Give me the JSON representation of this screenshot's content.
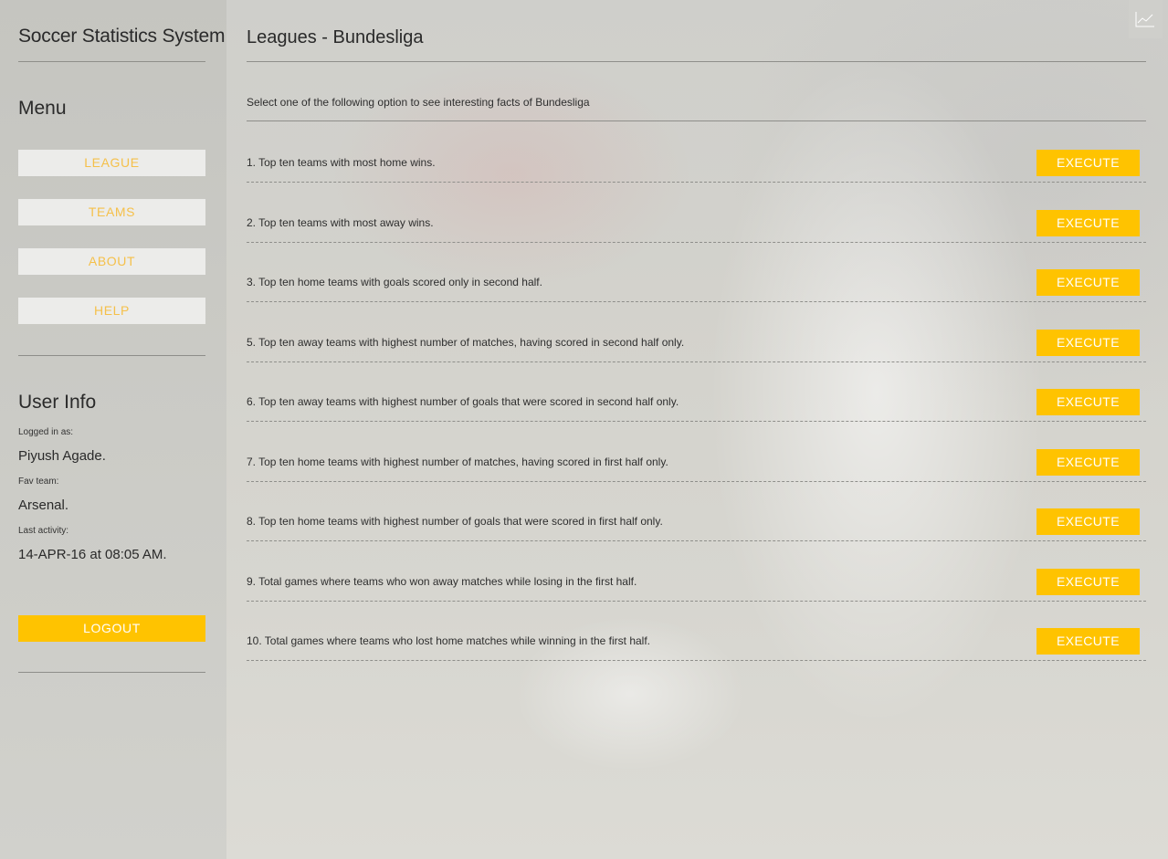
{
  "sidebar": {
    "app_title": "Soccer Statistics System",
    "menu_title": "Menu",
    "menu_items": [
      "LEAGUE",
      "TEAMS",
      "ABOUT",
      "HELP"
    ],
    "user_info": {
      "title": "User Info",
      "logged_in_label": "Logged in as:",
      "logged_in_value": "Piyush Agade.",
      "fav_team_label": "Fav team:",
      "fav_team_value": "Arsenal.",
      "last_activity_label": "Last activity:",
      "last_activity_value": "14-APR-16 at 08:05 AM."
    },
    "logout_label": "LOGOUT"
  },
  "main": {
    "page_title": "Leagues - Bundesliga",
    "intro": "Select one of the following option to see interesting facts of Bundesliga",
    "execute_label": "EXECUTE",
    "queries": [
      "1. Top ten teams with most home wins.",
      "2. Top ten teams with most away wins.",
      "3. Top ten home teams with goals scored only in second half.",
      "5. Top ten away teams with highest number of matches, having scored in second half only.",
      "6. Top ten away teams with highest number of goals that were scored in second half only.",
      "7. Top ten home teams with highest number of matches, having scored in first half only.",
      "8. Top ten home teams with highest number of goals that were scored in first half only.",
      "9. Total games where teams who won away matches while losing in the first half.",
      "10. Total games where teams who lost home matches while winning in the first half."
    ]
  },
  "corner_widget": {
    "icon": "line-chart-icon"
  },
  "colors": {
    "accent": "#ffc300",
    "menu_text": "#f5c04a",
    "menu_bg": "#ececea"
  }
}
